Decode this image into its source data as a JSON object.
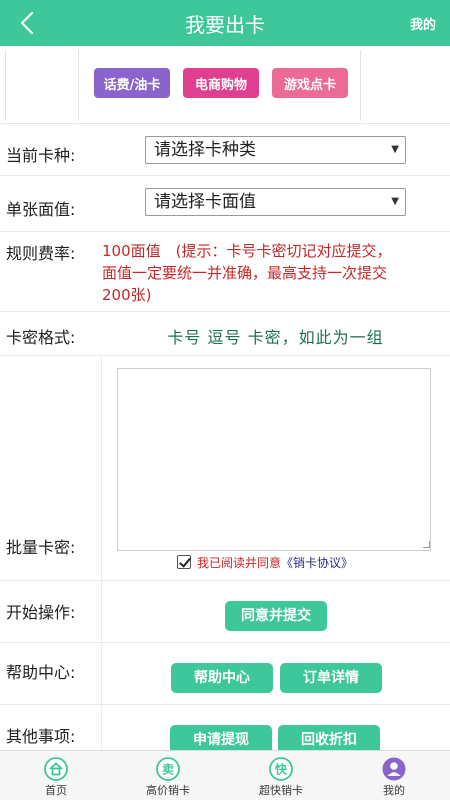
{
  "header": {
    "title": "我要出卡",
    "right_label": "我的"
  },
  "categories": [
    {
      "label": "话费/油卡",
      "color": "#8b63cc"
    },
    {
      "label": "电商购物",
      "color": "#de3f8f"
    },
    {
      "label": "游戏点卡",
      "color": "#ec6b94"
    }
  ],
  "form": {
    "card_type": {
      "label": "当前卡种:",
      "value": "请选择卡种类"
    },
    "face_value": {
      "label": "单张面值:",
      "value": "请选择卡面值"
    },
    "rate": {
      "label": "规则费率:",
      "text": "100面值　(提示：卡号卡密切记对应提交，面值一定要统一并准确，最高支持一次提交200张)"
    },
    "format": {
      "label": "卡密格式:",
      "text": "卡号 逗号 卡密，如此为一组"
    },
    "batch": {
      "label": "批量卡密:",
      "textarea_value": "",
      "agree_prefix": "我已阅读并同意",
      "agree_link": "《销卡协议》",
      "agreed": true
    },
    "start": {
      "label": "开始操作:",
      "button": "同意并提交"
    },
    "help": {
      "label": "帮助中心:",
      "buttons": [
        "帮助中心",
        "订单详情"
      ]
    },
    "other": {
      "label": "其他事项:",
      "buttons": [
        "申请提现",
        "回收折扣"
      ]
    }
  },
  "tabbar": [
    {
      "label": "首页",
      "icon": "home-icon"
    },
    {
      "label": "高价销卡",
      "icon": "sell-icon",
      "glyph": "卖"
    },
    {
      "label": "超快销卡",
      "icon": "fast-icon",
      "glyph": "快"
    },
    {
      "label": "我的",
      "icon": "user-icon"
    }
  ],
  "colors": {
    "primary": "#3ec79a",
    "warning_text": "#c62828",
    "format_text": "#1f6f55"
  }
}
